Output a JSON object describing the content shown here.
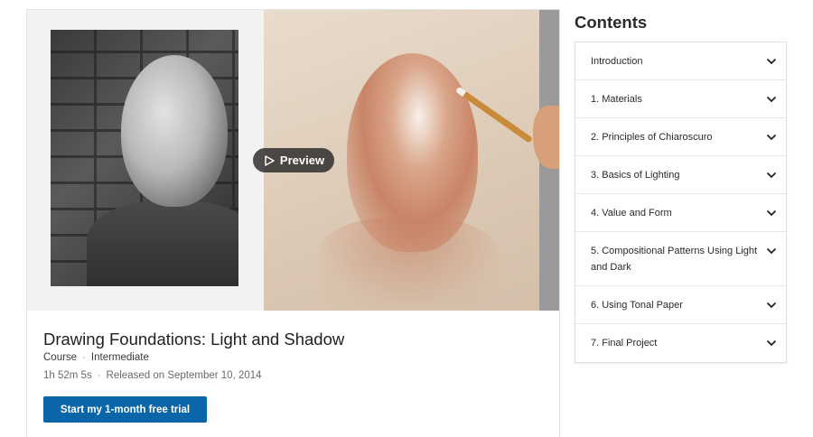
{
  "course": {
    "preview_label": "Preview",
    "title": "Drawing Foundations: Light and Shadow",
    "type": "Course",
    "level": "Intermediate",
    "duration": "1h 52m 5s",
    "released": "Released on September 10, 2014",
    "cta_label": "Start my 1-month free trial",
    "separator": "·"
  },
  "contents": {
    "heading": "Contents",
    "items": [
      {
        "label": "Introduction"
      },
      {
        "label": "1. Materials"
      },
      {
        "label": "2. Principles of Chiaroscuro"
      },
      {
        "label": "3. Basics of Lighting"
      },
      {
        "label": "4. Value and Form"
      },
      {
        "label": "5. Compositional Patterns Using Light and Dark"
      },
      {
        "label": "6. Using Tonal Paper"
      },
      {
        "label": "7. Final Project"
      }
    ]
  },
  "icons": {
    "play": "play-icon",
    "chevron": "chevron-down-icon"
  },
  "colors": {
    "accent": "#0a66a8"
  }
}
